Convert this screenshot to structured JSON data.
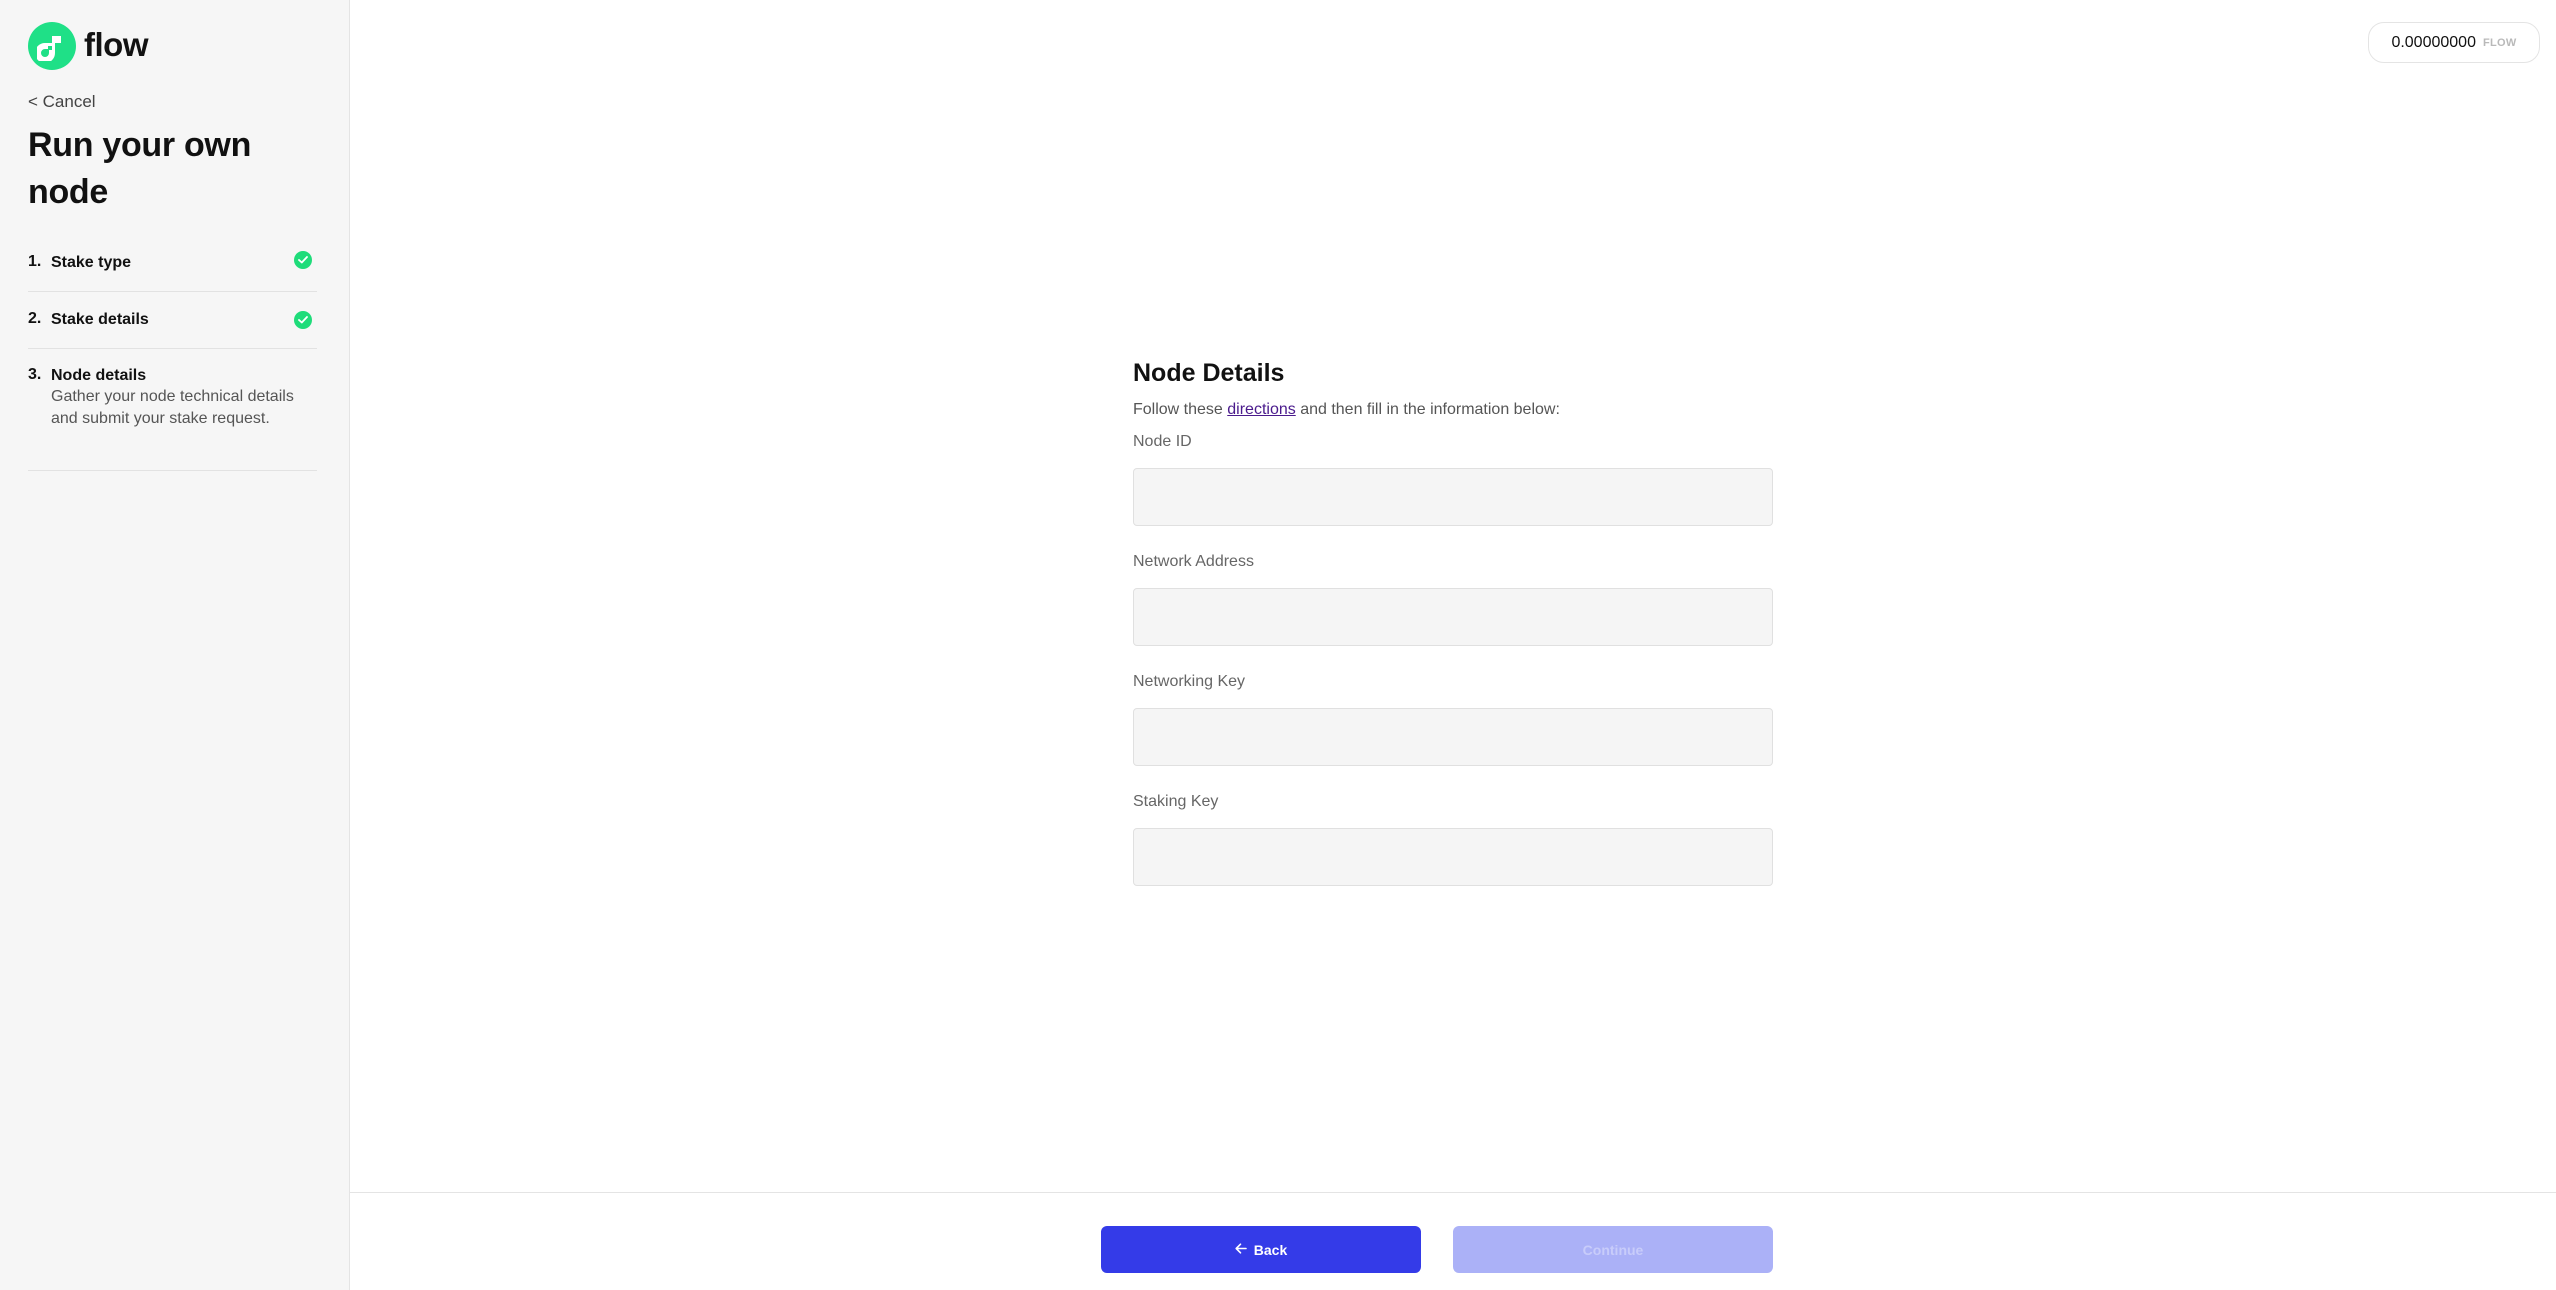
{
  "brand": {
    "name": "flow",
    "logo_icon": "flow-logo-icon",
    "accent_color": "#1fe087"
  },
  "sidebar": {
    "cancel_label": "< Cancel",
    "title": "Run your own node",
    "steps": [
      {
        "number": "1.",
        "title": "Stake type",
        "status": "completed",
        "icon": "check-circle-icon"
      },
      {
        "number": "2.",
        "title": "Stake details",
        "status": "completed",
        "icon": "check-circle-icon"
      },
      {
        "number": "3.",
        "title": "Node details",
        "status": "current",
        "description": "Gather your node technical details and submit your stake request."
      }
    ]
  },
  "header": {
    "balance": {
      "value": "0.00000000",
      "unit": "FLOW"
    }
  },
  "form": {
    "title": "Node Details",
    "subtitle_before": "Follow these ",
    "subtitle_link": "directions",
    "subtitle_after": " and then fill in the information below:",
    "fields": [
      {
        "label": "Node ID",
        "value": "",
        "placeholder": ""
      },
      {
        "label": "Network Address",
        "value": "",
        "placeholder": ""
      },
      {
        "label": "Networking Key",
        "value": "",
        "placeholder": ""
      },
      {
        "label": "Staking Key",
        "value": "",
        "placeholder": ""
      }
    ]
  },
  "footer": {
    "back_label": "Back",
    "back_icon": "arrow-left-icon",
    "continue_label": "Continue",
    "continue_disabled": true,
    "primary_color": "#343be8",
    "disabled_color": "#abb1f7"
  }
}
